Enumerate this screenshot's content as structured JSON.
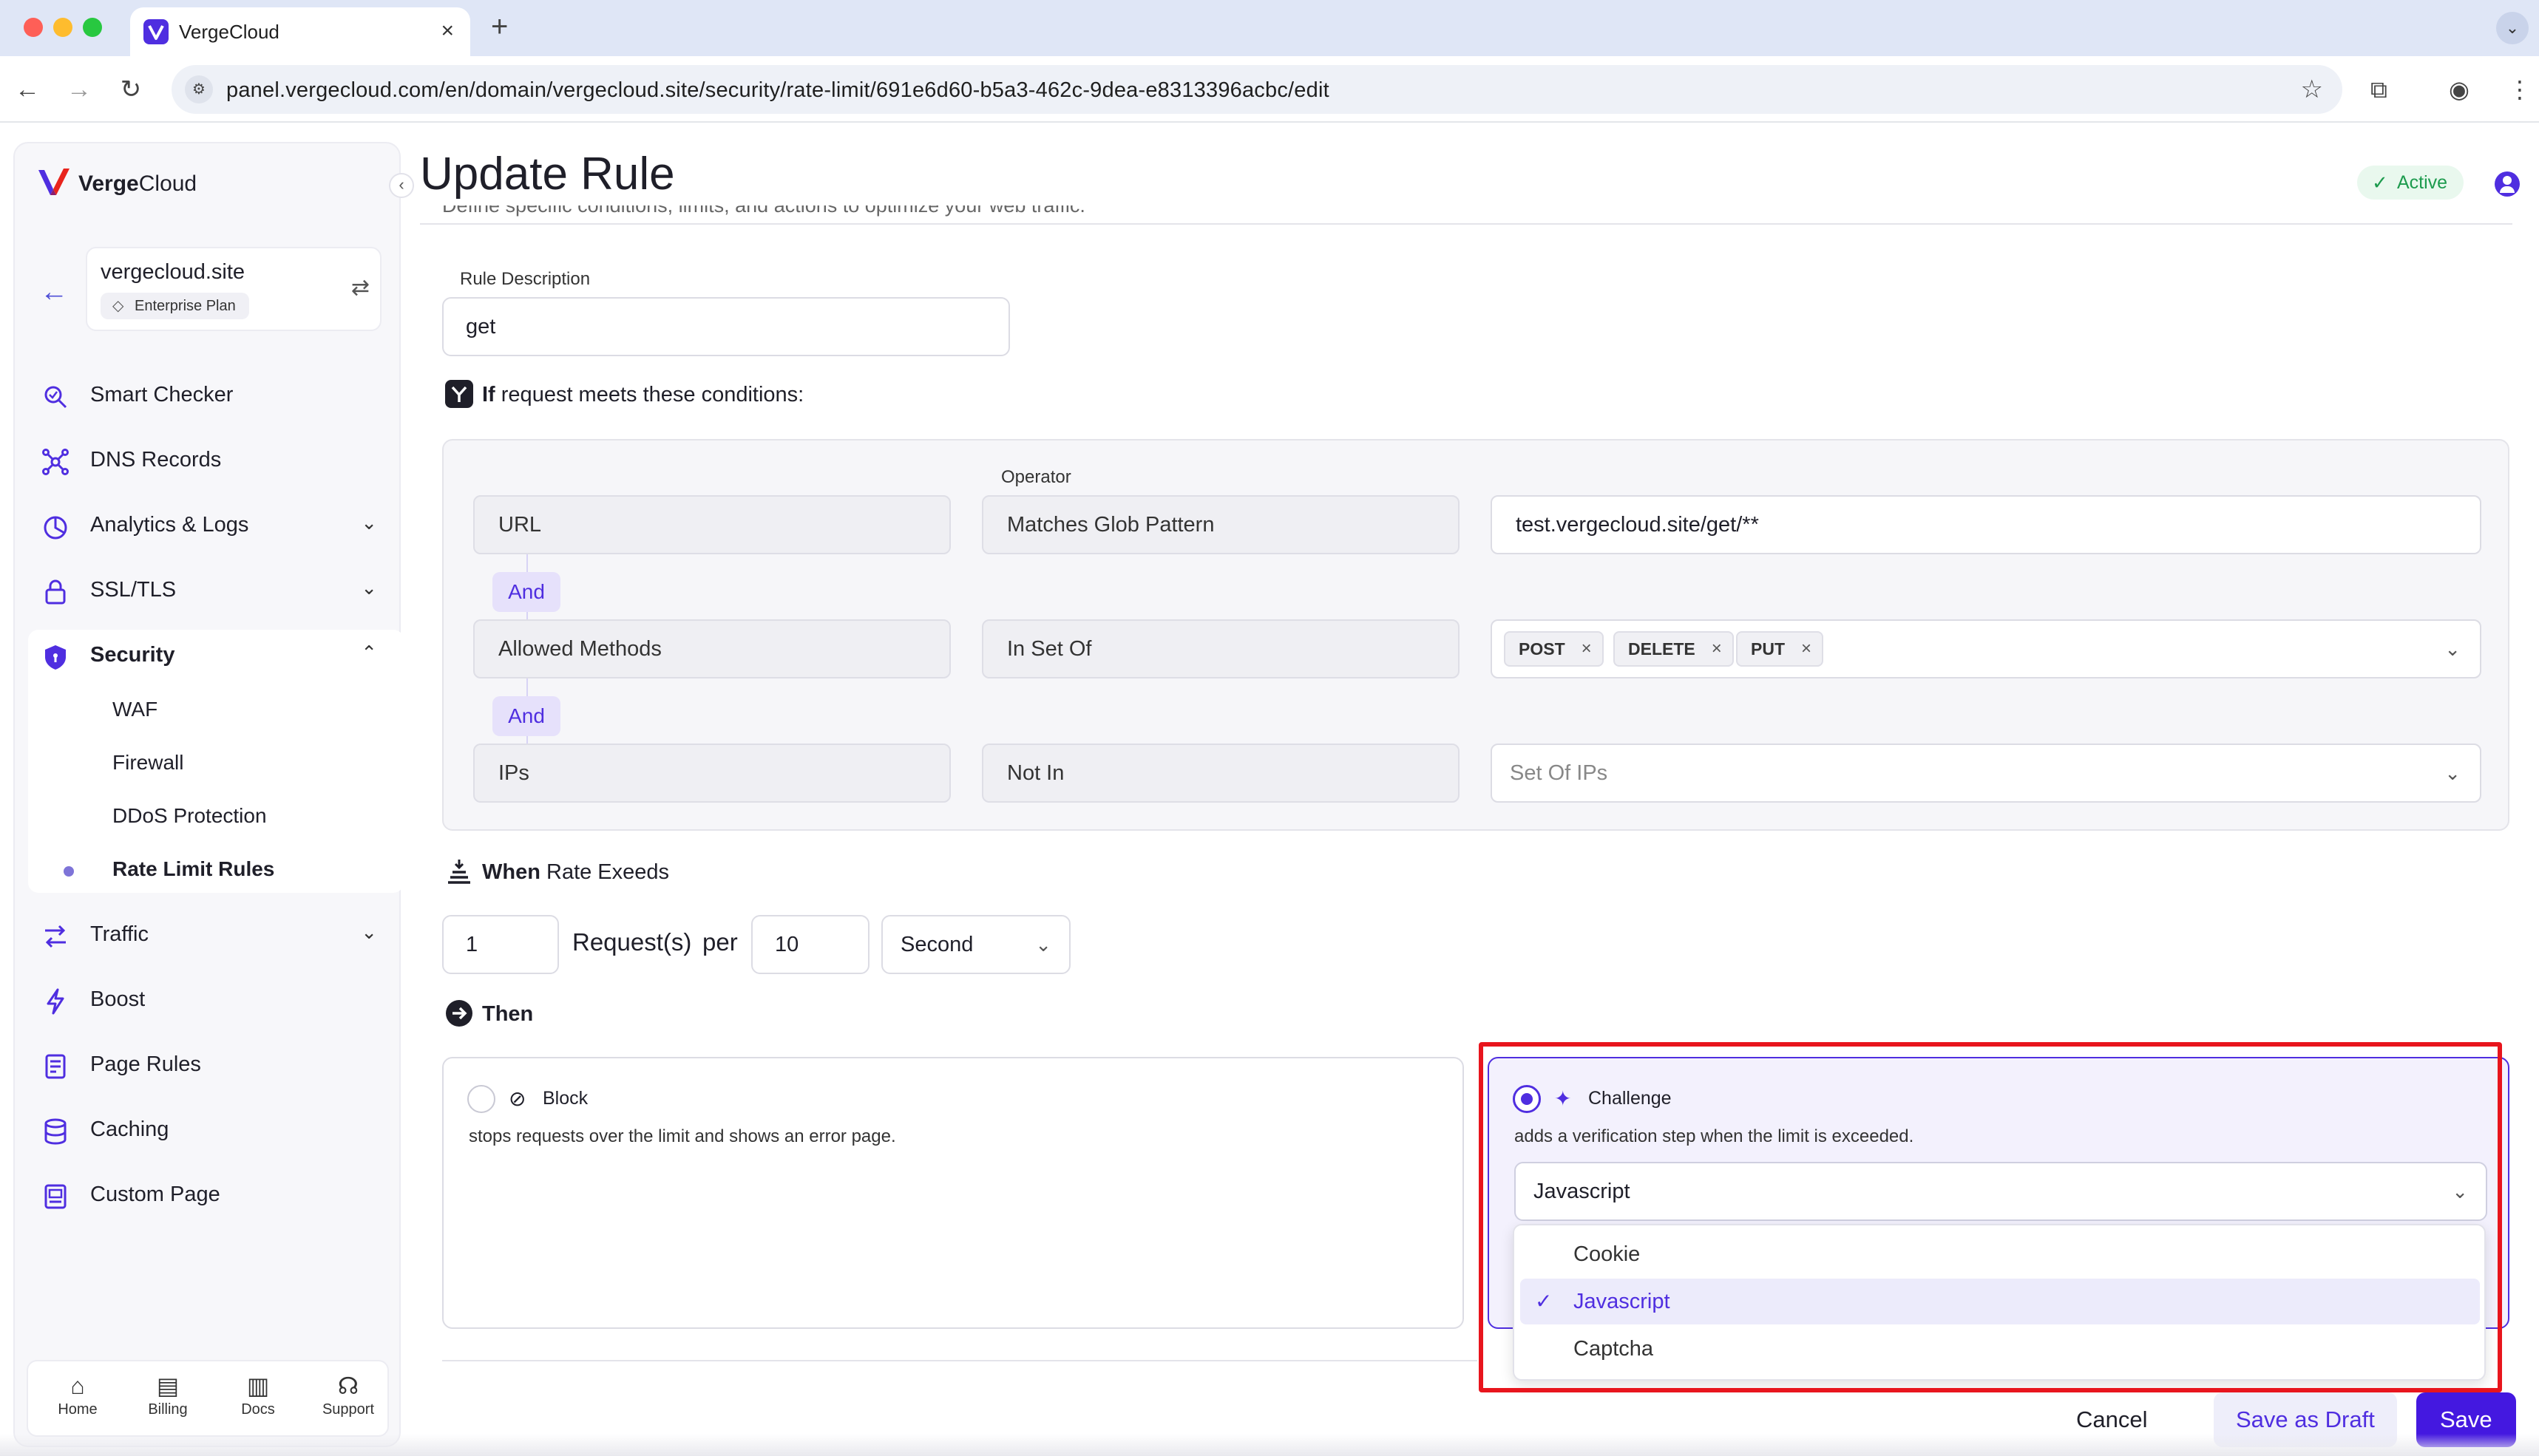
{
  "browser": {
    "tab_title": "VergeCloud",
    "tab_close": "×",
    "new_tab": "+",
    "url": "panel.vergecloud.com/en/domain/vergecloud.site/security/rate-limit/691e6d60-b5a3-462c-9dea-e8313396acbc/edit"
  },
  "sidebar": {
    "brand_bold": "Verge",
    "brand_light": "Cloud",
    "domain": "vergecloud.site",
    "plan": "Enterprise Plan",
    "items": [
      {
        "label": "Smart Checker",
        "icon": "smart-checker-icon"
      },
      {
        "label": "DNS Records",
        "icon": "dns-icon"
      },
      {
        "label": "Analytics & Logs",
        "icon": "analytics-icon"
      },
      {
        "label": "SSL/TLS",
        "icon": "lock-icon"
      },
      {
        "label": "Security",
        "icon": "shield-icon"
      },
      {
        "label": "Traffic",
        "icon": "traffic-icon"
      },
      {
        "label": "Boost",
        "icon": "bolt-icon"
      },
      {
        "label": "Page Rules",
        "icon": "page-rules-icon"
      },
      {
        "label": "Caching",
        "icon": "database-icon"
      },
      {
        "label": "Custom Page",
        "icon": "custom-page-icon"
      }
    ],
    "security_sub": [
      "WAF",
      "Firewall",
      "DDoS Protection",
      "Rate Limit Rules"
    ],
    "bottom_nav": [
      {
        "label": "Home",
        "icon": "home-icon"
      },
      {
        "label": "Billing",
        "icon": "billing-icon"
      },
      {
        "label": "Docs",
        "icon": "docs-icon"
      },
      {
        "label": "Support",
        "icon": "support-icon"
      }
    ]
  },
  "header": {
    "title": "Update Rule",
    "status": "Active",
    "subtitle": "Define specific conditions, limits, and actions to optimize your web traffic."
  },
  "form": {
    "description_label": "Rule Description",
    "description_value": "get",
    "if_bold": "If",
    "if_rest": " request meets these conditions:",
    "operator_label": "Operator",
    "and_label": "And",
    "conditions": [
      {
        "field": "URL",
        "operator": "Matches Glob Pattern",
        "value": "test.vergecloud.site/get/**"
      },
      {
        "field": "Allowed Methods",
        "operator": "In Set Of",
        "chips": [
          "POST",
          "DELETE",
          "PUT"
        ]
      },
      {
        "field": "IPs",
        "operator": "Not In",
        "placeholder": "Set Of IPs"
      }
    ],
    "when_bold": "When",
    "when_rest": " Rate Exeeds",
    "rate_requests": "1",
    "requests_label": "Request(s)",
    "per_label": "per",
    "rate_period": "10",
    "rate_unit": "Second",
    "then_label": "Then",
    "block_title": "Block",
    "block_desc": "stops requests over the limit and shows an error page.",
    "challenge_title": "Challenge",
    "challenge_desc": "adds a verification step when the limit is exceeded.",
    "challenge_selected": "Javascript",
    "challenge_options": [
      "Cookie",
      "Javascript",
      "Captcha"
    ]
  },
  "footer": {
    "cancel": "Cancel",
    "draft": "Save as Draft",
    "save": "Save"
  },
  "colors": {
    "accent": "#4f2ee0",
    "highlight": "#e8151d",
    "active_green": "#1d9b4e"
  }
}
